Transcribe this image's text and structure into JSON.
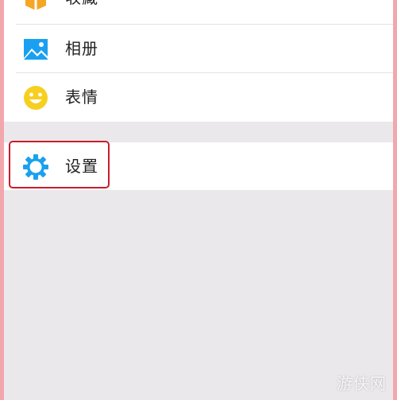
{
  "menu": {
    "items": [
      {
        "label": "收藏",
        "icon": "favorites-box-icon",
        "color": "#f5a623"
      },
      {
        "label": "相册",
        "icon": "album-image-icon",
        "color": "#1aa0f0"
      },
      {
        "label": "表情",
        "icon": "smiley-face-icon",
        "color": "#f7cf1e"
      }
    ],
    "settings": {
      "label": "设置",
      "icon": "gear-icon",
      "color": "#1aa0f0"
    }
  },
  "highlight_color": "#c81e2c",
  "watermark": "游侠网"
}
